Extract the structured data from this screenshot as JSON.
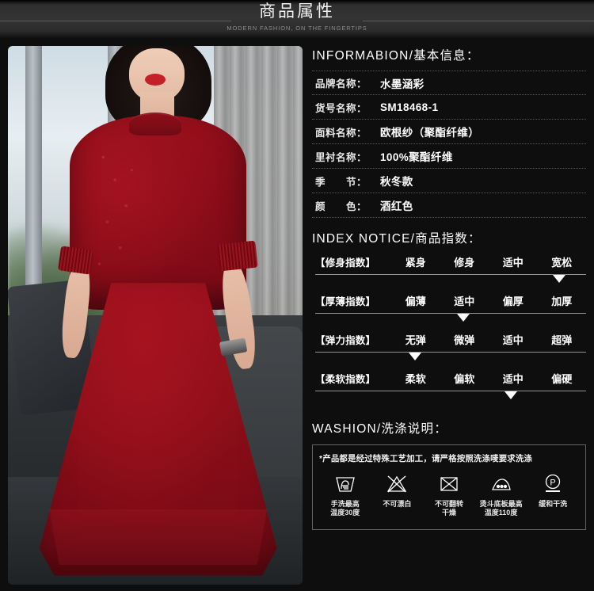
{
  "header": {
    "title": "商品属性",
    "subtitle": "MODERN FASHION, ON THE FINGERTIPS"
  },
  "photo": {
    "alt": "模特穿酒红色欧根纱连衣裙",
    "dress_color": "#8d0d1a"
  },
  "information": {
    "section_title": "INFORMABION/基本信息：",
    "rows": [
      {
        "label": "品牌名称：",
        "value": "水墨涵彩"
      },
      {
        "label": "货号名称：",
        "value": "SM18468-1"
      },
      {
        "label": "面料名称：",
        "value": "欧根纱（聚酯纤维）"
      },
      {
        "label": "里衬名称：",
        "value": "100%聚酯纤维"
      },
      {
        "label": "季　　节：",
        "value": "秋冬款"
      },
      {
        "label": "颜　　色：",
        "value": "酒红色"
      }
    ]
  },
  "index_notice": {
    "section_title": "INDEX NOTICE/商品指数：",
    "rows": [
      {
        "name": "【修身指数】",
        "options": [
          "紧身",
          "修身",
          "适中",
          "宽松"
        ],
        "selected_index": 3
      },
      {
        "name": "【厚薄指数】",
        "options": [
          "偏薄",
          "适中",
          "偏厚",
          "加厚"
        ],
        "selected_index": 1
      },
      {
        "name": "【弹力指数】",
        "options": [
          "无弹",
          "微弹",
          "适中",
          "超弹"
        ],
        "selected_index": 0
      },
      {
        "name": "【柔软指数】",
        "options": [
          "柔软",
          "偏软",
          "适中",
          "偏硬"
        ],
        "selected_index": 2
      }
    ]
  },
  "washion": {
    "section_title": "WASHION/洗涤说明：",
    "note": "*产品都是经过特殊工艺加工，请严格按照洗涤唛要求洗涤",
    "care_items": [
      {
        "icon": "hand-wash-icon",
        "label": "手洗最高\n温度30度"
      },
      {
        "icon": "do-not-bleach-icon",
        "label": "不可漂白"
      },
      {
        "icon": "do-not-tumble-dry-icon",
        "label": "不可翻转\n干燥"
      },
      {
        "icon": "iron-low-heat-icon",
        "label": "烫斗底板最高\n温度110度"
      },
      {
        "icon": "gentle-dry-clean-p-icon",
        "label": "缓和干洗"
      }
    ]
  }
}
